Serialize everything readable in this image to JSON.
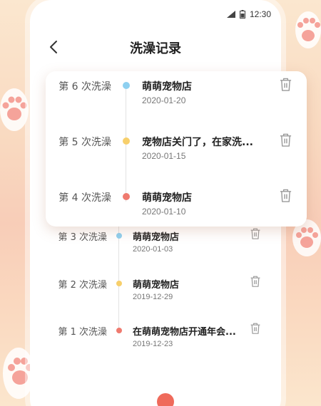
{
  "status": {
    "time": "12:30"
  },
  "header": {
    "title": "洗澡记录"
  },
  "records": [
    {
      "label": "第 6 次洗澡",
      "name": "萌萌宠物店",
      "date": "2020-01-20",
      "dot": "#8ed0f0"
    },
    {
      "label": "第 5 次洗澡",
      "name": "宠物店关门了，在家洗...",
      "date": "2020-01-15",
      "dot": "#f7cf6b"
    },
    {
      "label": "第 4 次洗澡",
      "name": "萌萌宠物店",
      "date": "2020-01-10",
      "dot": "#ef7a6f"
    },
    {
      "label": "第 3 次洗澡",
      "name": "萌萌宠物店",
      "date": "2020-01-03",
      "dot": "#8ed0f0"
    },
    {
      "label": "第 2 次洗澡",
      "name": "萌萌宠物店",
      "date": "2019-12-29",
      "dot": "#f7cf6b"
    },
    {
      "label": "第 1 次洗澡",
      "name": "在萌萌宠物店开通年会...",
      "date": "2019-12-23",
      "dot": "#ef7a6f"
    }
  ],
  "colors": {
    "accent": "#ef6a5b",
    "background": "#f9d9c0"
  }
}
